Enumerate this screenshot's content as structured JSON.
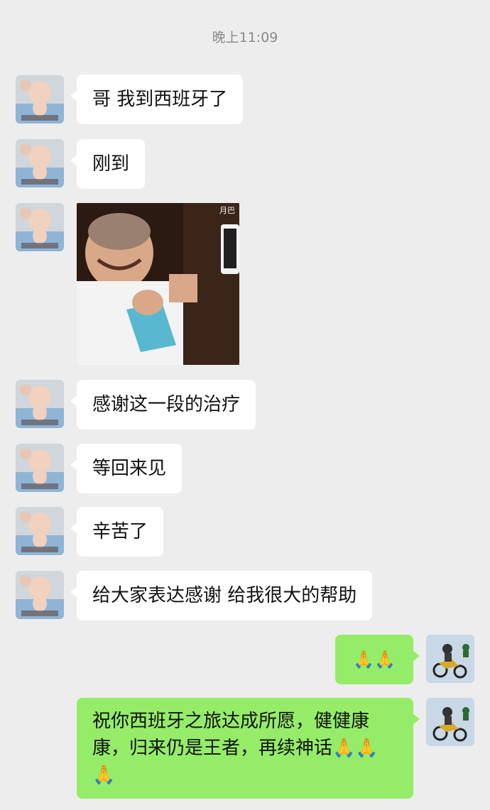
{
  "chat": {
    "timestamp": "晚上11:09",
    "messages": [
      {
        "sender": "contact",
        "type": "text",
        "text": "哥 我到西班牙了"
      },
      {
        "sender": "contact",
        "type": "text",
        "text": "刚到"
      },
      {
        "sender": "contact",
        "type": "sticker",
        "caption": "月巴"
      },
      {
        "sender": "contact",
        "type": "text",
        "text": "感谢这一段的治疗"
      },
      {
        "sender": "contact",
        "type": "text",
        "text": "等回来见"
      },
      {
        "sender": "contact",
        "type": "text",
        "text": "辛苦了"
      },
      {
        "sender": "contact",
        "type": "text",
        "text": "给大家表达感谢 给我很大的帮助"
      },
      {
        "sender": "me",
        "type": "emoji",
        "text": "🙏🙏"
      },
      {
        "sender": "me",
        "type": "text",
        "text": "祝你西班牙之旅达成所愿，健健康康，归来仍是王者，再续神话🙏🙏🙏"
      }
    ]
  },
  "colors": {
    "background": "#ededed",
    "incoming_bubble": "#ffffff",
    "outgoing_bubble": "#95ec69",
    "timestamp_text": "#8a8a8a"
  }
}
